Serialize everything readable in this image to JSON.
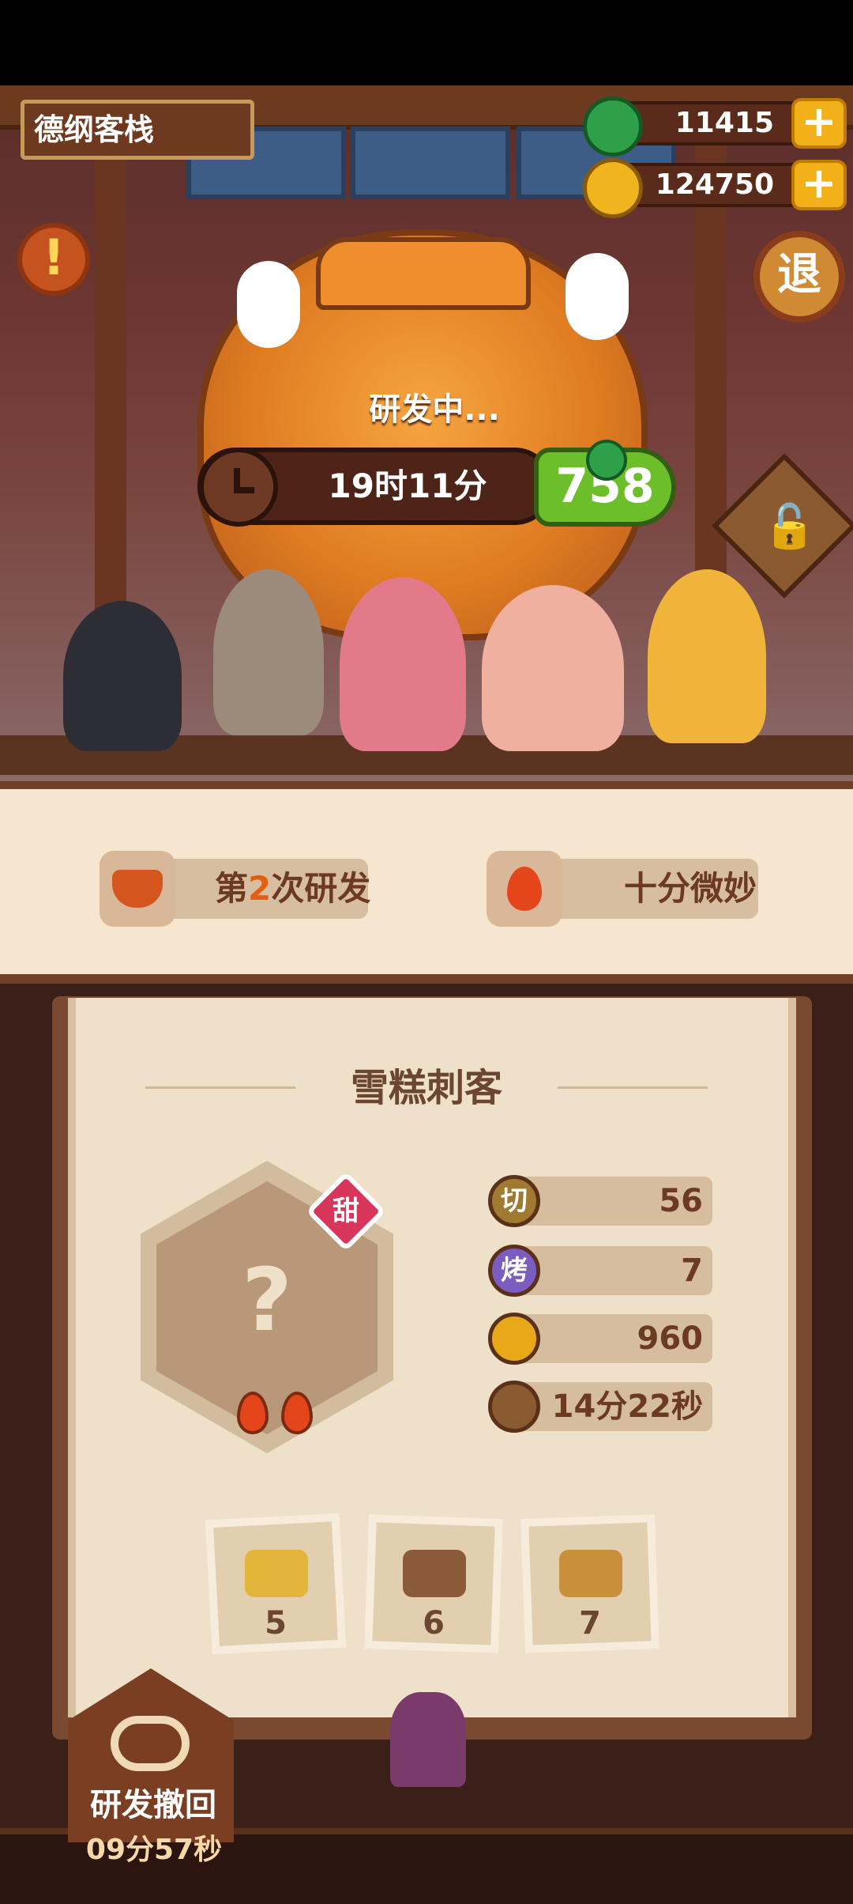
{
  "header": {
    "store_name": "德纲客栈",
    "jade_amount": "11415",
    "coin_amount": "124750",
    "plus_label": "+",
    "exit_label": "退",
    "alert_label": "!"
  },
  "research": {
    "status": "研发中...",
    "time_left": "19时11分",
    "speedup_cost": "758"
  },
  "info": {
    "count_text_prefix": "第",
    "count_number": "2",
    "count_text_suffix": "次研发",
    "quality": "十分微妙"
  },
  "recipe": {
    "name": "雪糕刺客",
    "tag": "甜",
    "unknown_mark": "?",
    "flames": 2,
    "stats": [
      {
        "icon_label": "切",
        "value": "56",
        "color": "#a07a30"
      },
      {
        "icon_label": "烤",
        "value": "7",
        "color": "#7b5cc0"
      },
      {
        "icon_label": "",
        "value": "960",
        "color": "#e8a818"
      },
      {
        "icon_label": "",
        "value": "14分22秒",
        "color": "#8a5a30"
      }
    ],
    "ingredients": [
      {
        "icon": "fruit-icon",
        "count": "5"
      },
      {
        "icon": "cream-bowl-icon",
        "count": "6"
      },
      {
        "icon": "bento-box-icon",
        "count": "7"
      }
    ]
  },
  "undo": {
    "label": "研发撤回",
    "time": "09分57秒"
  },
  "colors": {
    "accent_green": "#6cbf2a",
    "accent_orange": "#e06010",
    "panel_paper": "#efe1c9",
    "wood": "#6e3a1f"
  }
}
